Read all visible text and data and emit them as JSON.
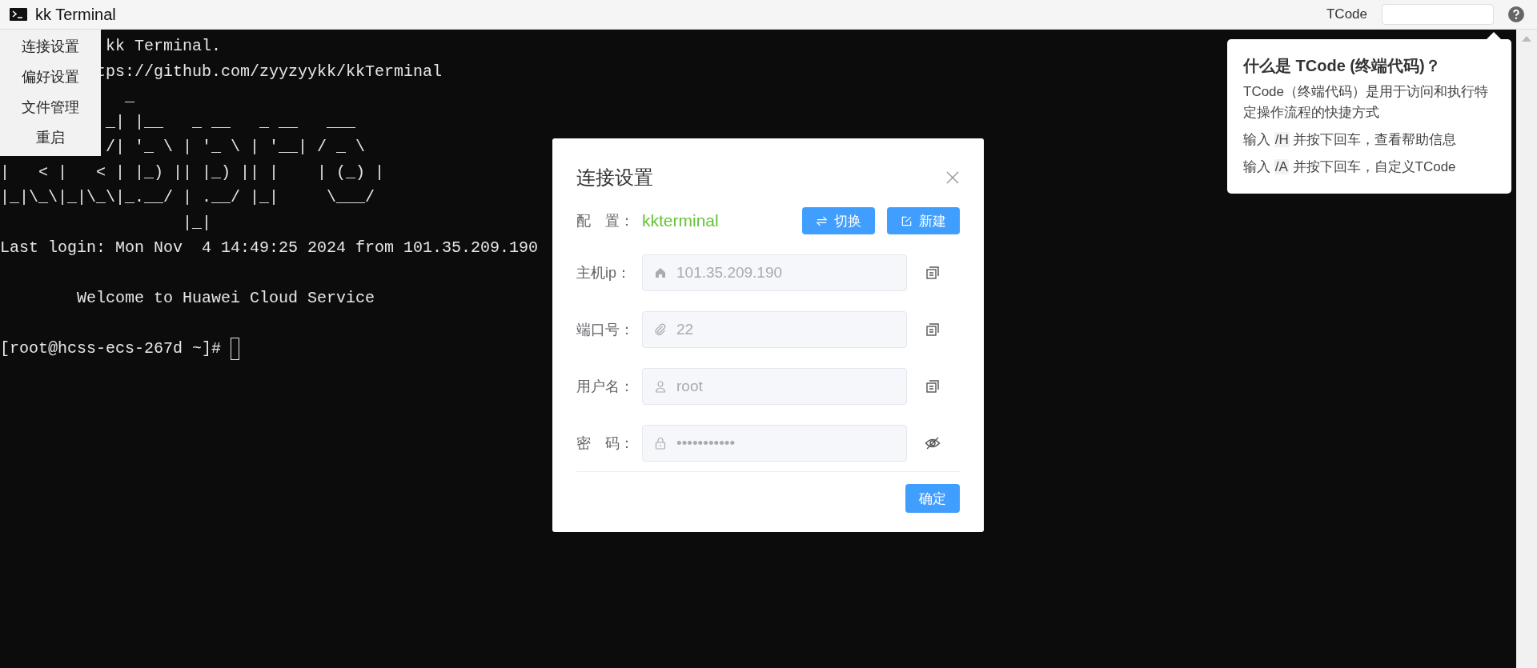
{
  "window": {
    "title": "kk Terminal"
  },
  "tcode": {
    "label": "TCode"
  },
  "menu": {
    "items": [
      {
        "label": "连接设置"
      },
      {
        "label": "偏好设置"
      },
      {
        "label": "文件管理"
      },
      {
        "label": "重启"
      }
    ]
  },
  "terminal": {
    "lines": [
      {
        "kind": "text",
        "text": "           kk Terminal."
      },
      {
        "kind": "text",
        "text": "          tps://github.com/zyyzyykk/kkTerminal"
      },
      {
        "kind": "text",
        "text": "             _"
      },
      {
        "kind": "text",
        "text": "           _| |__   _ __   _ __   ___"
      },
      {
        "kind": "text",
        "text": "           /| '_ \\ | '_ \\ | '__| / _ \\"
      },
      {
        "kind": "text",
        "text": "|   < |   < | |_) || |_) || |    | (_) |"
      },
      {
        "kind": "text",
        "text": "|_|\\_\\|_|\\_\\|_.__/ | .__/ |_|     \\___/"
      },
      {
        "kind": "text",
        "text": "                   |_|"
      },
      {
        "kind": "text",
        "text": "Last login: Mon Nov  4 14:49:25 2024 from 101.35.209.190"
      },
      {
        "kind": "blank"
      },
      {
        "kind": "text",
        "text": "        Welcome to Huawei Cloud Service"
      },
      {
        "kind": "blank"
      },
      {
        "kind": "prompt",
        "text": "[root@hcss-ecs-267d ~]# "
      }
    ]
  },
  "dialog": {
    "title": "连接设置",
    "config_label": "配　置：",
    "config_name": "kkterminal",
    "buttons": [
      {
        "kind": "switch",
        "label": "切换"
      },
      {
        "kind": "new",
        "label": "新建"
      }
    ],
    "fields": [
      {
        "kind": "host",
        "label": "主机ip：",
        "value": "101.35.209.190"
      },
      {
        "kind": "port",
        "label": "端口号：",
        "value": "22"
      },
      {
        "kind": "user",
        "label": "用户名：",
        "value": "root"
      },
      {
        "kind": "password",
        "label": "密　码：",
        "value": "•••••••••••"
      }
    ],
    "confirm": "确定"
  },
  "help_popover": {
    "title": "什么是 TCode (终端代码)？",
    "intro": "TCode（终端代码）是用于访问和执行特定操作流程的快捷方式",
    "lines": [
      {
        "prefix": "输入",
        "code": "/H",
        "suffix": "并按下回车，查看帮助信息"
      },
      {
        "prefix": "输入",
        "code": "/A",
        "suffix": "并按下回车，自定义TCode"
      }
    ]
  }
}
